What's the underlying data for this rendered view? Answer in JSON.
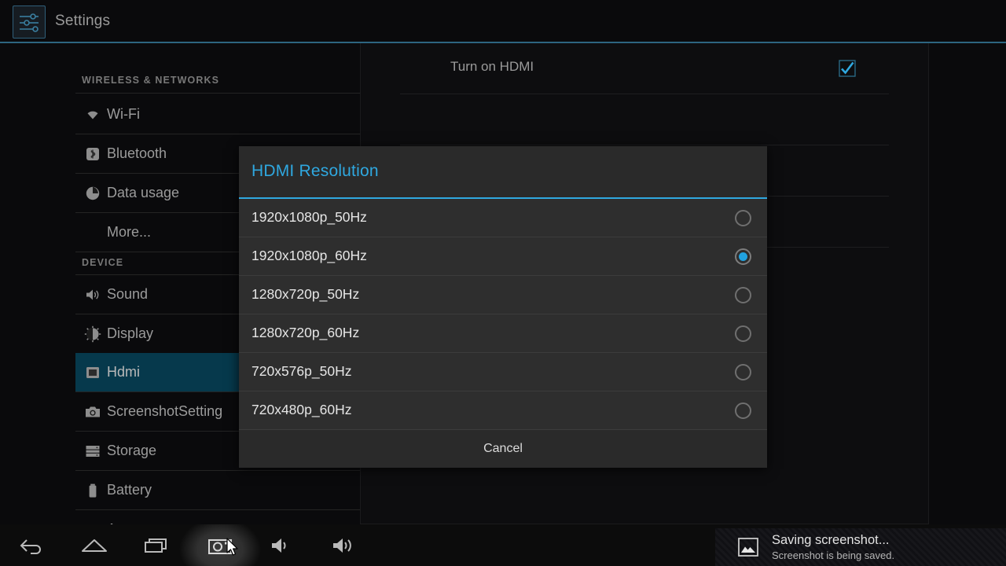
{
  "titlebar": {
    "app_name": "Settings",
    "icon": "settings-sliders-icon",
    "accent_rule_color": "#2d6580"
  },
  "sidebar": {
    "sections": [
      {
        "header": "WIRELESS & NETWORKS",
        "items": [
          {
            "label": "Wi-Fi",
            "icon": "wifi-icon",
            "selected": false
          },
          {
            "label": "Bluetooth",
            "icon": "bluetooth-icon",
            "selected": false
          },
          {
            "label": "Data usage",
            "icon": "data-usage-icon",
            "selected": false
          },
          {
            "label": "More...",
            "icon": "none",
            "selected": false
          }
        ]
      },
      {
        "header": "DEVICE",
        "items": [
          {
            "label": "Sound",
            "icon": "sound-icon",
            "selected": false
          },
          {
            "label": "Display",
            "icon": "display-icon",
            "selected": false
          },
          {
            "label": "Hdmi",
            "icon": "hdmi-icon",
            "selected": true
          },
          {
            "label": "ScreenshotSetting",
            "icon": "camera-icon",
            "selected": false
          },
          {
            "label": "Storage",
            "icon": "storage-icon",
            "selected": false
          },
          {
            "label": "Battery",
            "icon": "battery-icon",
            "selected": false
          },
          {
            "label": "Apps",
            "icon": "apps-icon",
            "selected": false
          }
        ]
      }
    ],
    "selected_color": "#06394c"
  },
  "content": {
    "rows": [
      {
        "label": "Turn on HDMI",
        "checkbox": true
      }
    ],
    "checkbox_color": "#2fa8e0"
  },
  "dialog": {
    "title": "HDMI Resolution",
    "title_color": "#2fa8e0",
    "options": [
      {
        "label": "1920x1080p_50Hz",
        "selected": false
      },
      {
        "label": "1920x1080p_60Hz",
        "selected": true
      },
      {
        "label": "1280x720p_50Hz",
        "selected": false
      },
      {
        "label": "1280x720p_60Hz",
        "selected": false
      },
      {
        "label": "720x576p_50Hz",
        "selected": false
      },
      {
        "label": "720x480p_60Hz",
        "selected": false
      }
    ],
    "cancel_label": "Cancel",
    "radio_selected_color": "#21a2e0"
  },
  "navbar": {
    "buttons": [
      {
        "name": "back",
        "icon": "back-arrow-icon"
      },
      {
        "name": "home",
        "icon": "home-icon"
      },
      {
        "name": "recents",
        "icon": "recents-icon"
      },
      {
        "name": "screenshot",
        "icon": "camera-icon",
        "highlighted": true
      },
      {
        "name": "volume-down",
        "icon": "volume-down-icon"
      },
      {
        "name": "volume-up",
        "icon": "volume-up-icon"
      }
    ]
  },
  "toast": {
    "title": "Saving screenshot...",
    "subtitle": "Screenshot is being saved.",
    "icon": "image-icon"
  }
}
